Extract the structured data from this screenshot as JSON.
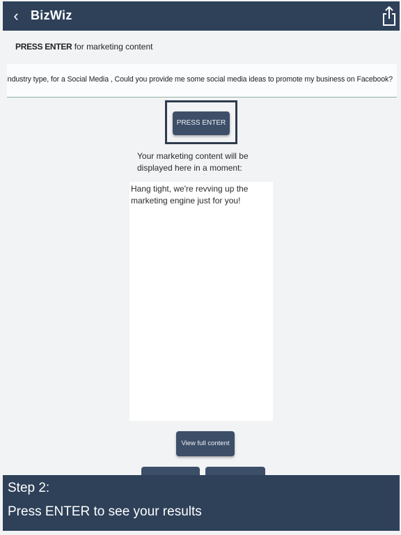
{
  "header": {
    "title": "BizWiz",
    "back_glyph": "‹",
    "back_icon": "back-chevron-icon",
    "share_icon": "share-icon"
  },
  "prompt": {
    "bold": "PRESS ENTER",
    "rest": " for marketing content"
  },
  "query": {
    "value": "ng/Advertising/Sales industry type,  for a Social Media , Could you provide me some social media ideas to promote my business on Facebook?"
  },
  "actions": {
    "press_enter": "PRESS ENTER",
    "view_full": "View full content"
  },
  "status": {
    "waiting": "Your marketing content will be displayed here in a moment:",
    "output": "Hang tight, we're revving up the marketing engine just for you!"
  },
  "tutorial": {
    "step": "Step 2:",
    "instruction": "Press ENTER to see your results"
  },
  "colors": {
    "nav": "#2e4159",
    "button": "#3d4e68",
    "background": "#f2f3f5"
  }
}
